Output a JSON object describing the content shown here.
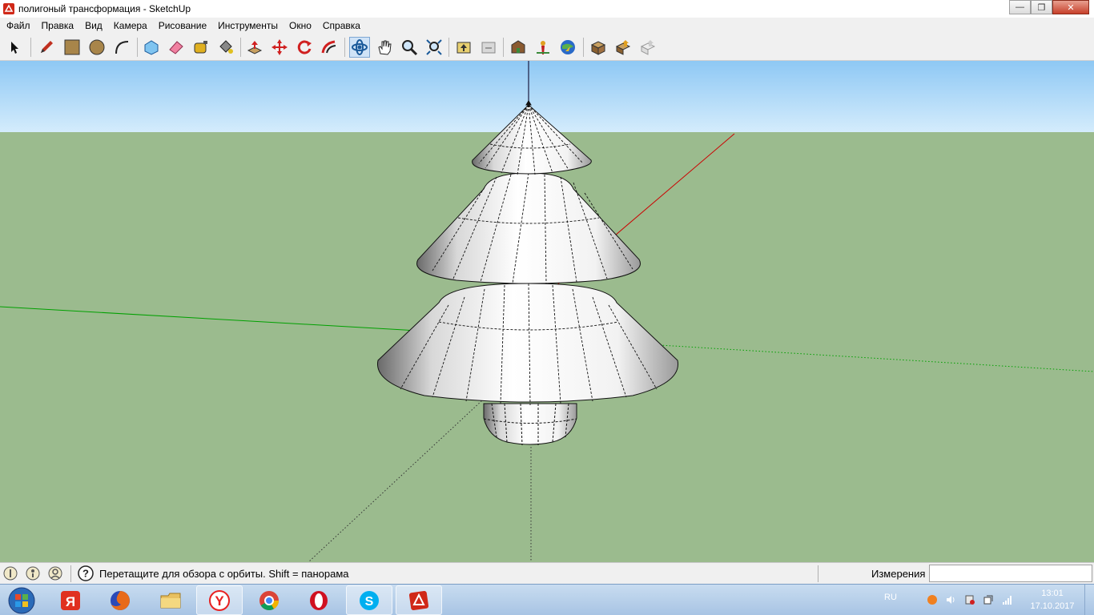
{
  "window": {
    "title": "полигоный трансформация - SketchUp",
    "controls": [
      "minimize",
      "restore",
      "close"
    ]
  },
  "menu": [
    "Файл",
    "Правка",
    "Вид",
    "Камера",
    "Рисование",
    "Инструменты",
    "Окно",
    "Справка"
  ],
  "toolbar": {
    "tools": [
      {
        "name": "select-icon",
        "active": false
      },
      {
        "name": "pencil-icon",
        "active": false
      },
      {
        "name": "rectangle-icon",
        "active": false
      },
      {
        "name": "circle-icon",
        "active": false
      },
      {
        "name": "arc-icon",
        "active": false
      },
      {
        "name": "make-component-icon",
        "active": false
      },
      {
        "name": "eraser-icon",
        "active": false
      },
      {
        "name": "tape-measure-icon",
        "active": false
      },
      {
        "name": "paint-bucket-icon",
        "active": false
      },
      {
        "name": "push-pull-icon",
        "active": false
      },
      {
        "name": "move-icon",
        "active": false
      },
      {
        "name": "rotate-icon",
        "active": false
      },
      {
        "name": "follow-me-icon",
        "active": false
      },
      {
        "name": "orbit-icon",
        "active": true
      },
      {
        "name": "pan-icon",
        "active": false
      },
      {
        "name": "zoom-icon",
        "active": false
      },
      {
        "name": "zoom-extents-icon",
        "active": false
      },
      {
        "name": "previous-view-icon",
        "active": false
      },
      {
        "name": "next-view-icon",
        "active": false
      },
      {
        "name": "3d-warehouse-icon",
        "active": false
      },
      {
        "name": "add-location-icon",
        "active": false
      },
      {
        "name": "google-earth-icon",
        "active": false
      },
      {
        "name": "get-models-icon",
        "active": false
      },
      {
        "name": "share-model-icon",
        "active": false
      },
      {
        "name": "share-component-icon",
        "active": false
      }
    ]
  },
  "status": {
    "message": "Перетащите для обзора с орбиты.  Shift = панорама",
    "measurements_label": "Измерения",
    "measurements_value": ""
  },
  "taskbar": {
    "start": "start-orb-icon",
    "apps": [
      {
        "name": "yandex-disk-icon",
        "letter": "Я",
        "color": "#e03020"
      },
      {
        "name": "firefox-icon",
        "letter": "",
        "color": "#e86a1a"
      },
      {
        "name": "explorer-icon",
        "letter": "",
        "color": "#e8c060"
      },
      {
        "name": "yandex-browser-icon",
        "letter": "Y",
        "color": "#e82020"
      },
      {
        "name": "chrome-icon",
        "letter": "",
        "color": "#2a9a3a"
      },
      {
        "name": "opera-icon",
        "letter": "O",
        "color": "#d01020"
      },
      {
        "name": "skype-icon",
        "letter": "S",
        "color": "#00aff0"
      },
      {
        "name": "sketchup-icon",
        "letter": "",
        "color": "#d02818"
      }
    ],
    "language": "RU",
    "time": "13:01",
    "date": "17.10.2017"
  },
  "colors": {
    "sky_top": "#8ec8f4",
    "sky_bottom": "#d4ecfc",
    "ground": "#9bbb8e",
    "red_axis": "#cc0000",
    "green_axis": "#00a000"
  }
}
